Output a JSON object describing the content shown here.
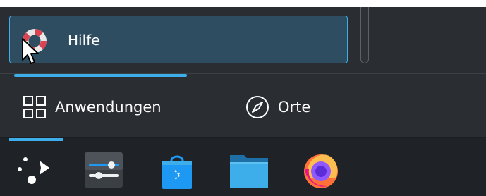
{
  "favorites": {
    "items": [
      {
        "label": "Hilfe",
        "icon": "lifebuoy-icon"
      }
    ]
  },
  "tabs": [
    {
      "label": "Anwendungen",
      "icon": "grid-icon",
      "active": true
    },
    {
      "label": "Orte",
      "icon": "compass-icon",
      "active": false
    }
  ],
  "taskbar": {
    "items": [
      {
        "icon": "application-launcher-icon",
        "active": true
      },
      {
        "icon": "system-settings-icon",
        "active": false
      },
      {
        "icon": "discover-icon",
        "active": false
      },
      {
        "icon": "file-manager-icon",
        "active": false
      },
      {
        "icon": "firefox-icon",
        "active": false
      }
    ]
  },
  "colors": {
    "accent": "#3daee9",
    "background": "#2a2e32",
    "panel": "#1f2226",
    "highlight": "#2f4d60"
  }
}
